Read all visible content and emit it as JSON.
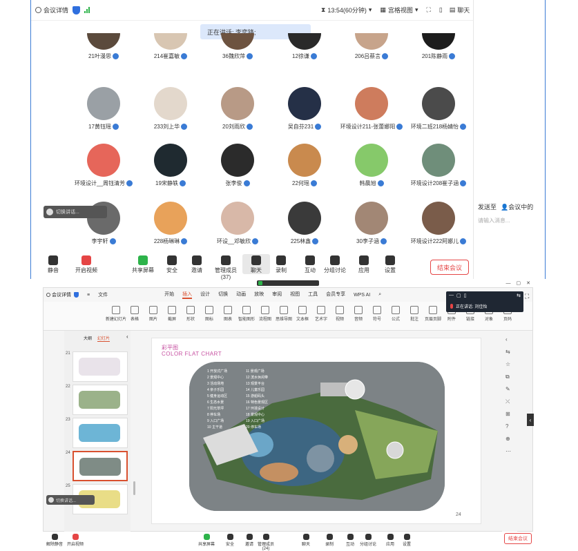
{
  "meeting": {
    "details_label": "会议详情",
    "timer": "13:54(60分钟)",
    "view_mode": "宫格视图",
    "chat_label": "聊天",
    "speaking": "正在讲话: 李奕锋;"
  },
  "participants": [
    {
      "name": "21叶漫思"
    },
    {
      "name": "214崔嘉敏"
    },
    {
      "name": "36魏欣萍"
    },
    {
      "name": "12徐谦"
    },
    {
      "name": "206吕蔡言"
    },
    {
      "name": "201陈静雨"
    },
    {
      "name": "17黄钰瑶"
    },
    {
      "name": "233刘上华"
    },
    {
      "name": "20刘雨欣"
    },
    {
      "name": "吴自芬231"
    },
    {
      "name": "环境设计211-张蕾娜阳"
    },
    {
      "name": "环境二班218杨婧怡"
    },
    {
      "name": "环境设计__周钰清芳"
    },
    {
      "name": "19宋静轶"
    },
    {
      "name": "张李俊"
    },
    {
      "name": "22何瑶"
    },
    {
      "name": "韩晨旭"
    },
    {
      "name": "环境设计208崔子涵"
    },
    {
      "name": "李宇轩"
    },
    {
      "name": "228杨琳琳"
    },
    {
      "name": "环设__邓敏欣"
    },
    {
      "name": "225林鑫"
    },
    {
      "name": "30李子涵"
    },
    {
      "name": "环境设计222阿娜儿"
    }
  ],
  "chat": {
    "send_to": "发送至",
    "target": "会议中的",
    "placeholder": "请输入消息..."
  },
  "toolbar": [
    {
      "label": "静音"
    },
    {
      "label": "开启视频"
    },
    {
      "label": "共享屏幕"
    },
    {
      "label": "安全"
    },
    {
      "label": "邀请"
    },
    {
      "label": "管理成员(37)"
    },
    {
      "label": "聊天"
    },
    {
      "label": "录制"
    },
    {
      "label": "互动"
    },
    {
      "label": "分组讨论"
    },
    {
      "label": "应用"
    },
    {
      "label": "设置"
    }
  ],
  "end_meeting": "结束会议",
  "muted_tag": "切换讲话...",
  "wps": {
    "menu_file": "文件",
    "tabs": [
      "开始",
      "插入",
      "设计",
      "切换",
      "动画",
      "放映",
      "审阅",
      "视图",
      "工具",
      "会员专享"
    ],
    "active_tab": "插入",
    "wps_ai": "WPS AI",
    "ribbon": [
      "新建幻灯片",
      "表格",
      "图片",
      "截屏",
      "形状",
      "图标",
      "图表",
      "智能图形",
      "流程图",
      "思维导图",
      "文本框",
      "艺术字",
      "视频",
      "音频",
      "符号",
      "公式",
      "批注",
      "页眉页脚",
      "附件",
      "链接",
      "对象",
      "页码"
    ],
    "outline_tabs": [
      "大纲",
      "幻灯片"
    ],
    "slide_numbers": [
      "21",
      "22",
      "23",
      "24",
      "25"
    ],
    "slide_title": "彩平图",
    "slide_subtitle": "COLOR FLAT CHART",
    "page_number": "24",
    "legend": [
      "1 开放式广场",
      "2 景观中心",
      "3 活动场地",
      "4 亲子乐园",
      "5 健身运动区",
      "6 生态水景",
      "7 阳光草坪",
      "8 停车场",
      "9 入口广场",
      "10 主干道",
      "11 景观广场",
      "12 滨水休闲带",
      "13 观景平台",
      "14 儿童乐园",
      "15 游船码头",
      "16 特色景观区",
      "17 环境设计",
      "18 景观中心",
      "19 入口广场",
      "20 停车场"
    ]
  },
  "mini": {
    "label": "正在讲话: 刘佳怡"
  },
  "lower_toolbar": [
    {
      "label": "解除静音"
    },
    {
      "label": "开启视频"
    },
    {
      "label": "共享屏幕"
    },
    {
      "label": "安全"
    },
    {
      "label": "邀请"
    },
    {
      "label": "管理成员(24)"
    },
    {
      "label": "聊天"
    },
    {
      "label": "录制"
    },
    {
      "label": "互动"
    },
    {
      "label": "分组讨论"
    },
    {
      "label": "应用"
    },
    {
      "label": "设置"
    }
  ],
  "colors": {
    "accent": "#3a7bd5",
    "end": "#e54545",
    "wps_orange": "#d9502f"
  }
}
